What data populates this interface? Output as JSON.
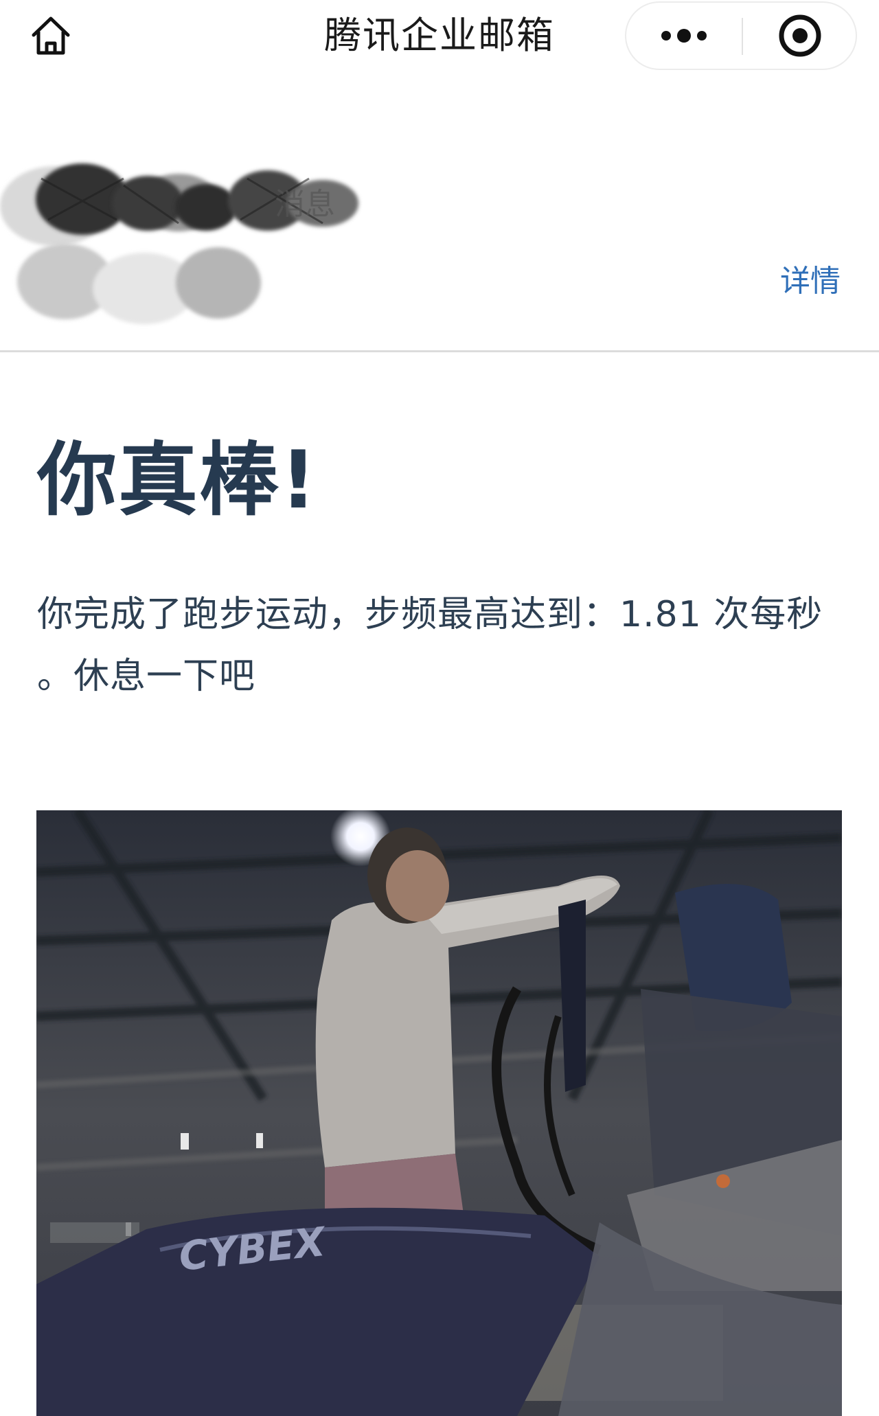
{
  "navbar": {
    "title": "腾讯企业邮箱",
    "home_icon": "home-icon",
    "more_icon": "more-dots-icon",
    "close_icon": "target-close-icon"
  },
  "sender": {
    "name_redacted": "消息",
    "detail_label": "详情"
  },
  "message": {
    "headline": "你真棒!",
    "body": "你完成了跑步运动，步频最高达到：1.81 次每秒 。休息一下吧",
    "stat_value": "1.81",
    "stat_unit": "次每秒"
  },
  "photo": {
    "brand_text": "CYBEX"
  },
  "colors": {
    "headline": "#263a50",
    "body_text": "#2d3f52",
    "link": "#2f6fb8",
    "divider": "#dcdcdc"
  }
}
